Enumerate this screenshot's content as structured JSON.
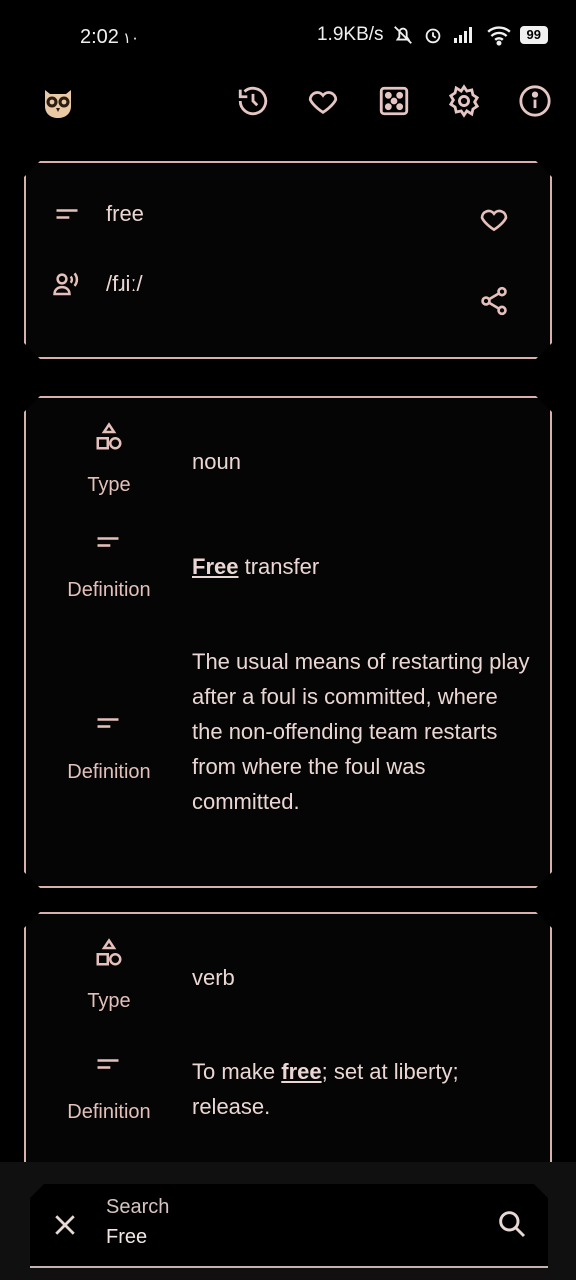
{
  "status_bar": {
    "time": "2:02",
    "time_extra": "١٠",
    "net_speed": "1.9KB/s",
    "battery": "99"
  },
  "app_bar": {
    "icons": [
      "owl-logo-icon",
      "history-icon",
      "heart-icon",
      "dice-icon",
      "settings-icon",
      "info-icon"
    ]
  },
  "word": {
    "text": "free",
    "pronunciation": "/fɹiː/"
  },
  "entries": [
    {
      "type_label": "Type",
      "type_value": "noun",
      "definitions": [
        {
          "label": "Definition",
          "bold": "Free",
          "rest": " transfer"
        },
        {
          "label": "Definition",
          "bold": "",
          "rest": "The usual means of restarting play after a foul is committed, where the non-offending team restarts from where the foul was committed."
        }
      ]
    },
    {
      "type_label": "Type",
      "type_value": "verb",
      "definitions": [
        {
          "label": "Definition",
          "prefix": "To make ",
          "bold": "free",
          "rest": "; set at liberty; release."
        }
      ]
    }
  ],
  "search": {
    "label": "Search",
    "value": "Free"
  },
  "colors": {
    "accent": "#d7b1ab",
    "background": "#000000",
    "text": "#ead7d3"
  }
}
